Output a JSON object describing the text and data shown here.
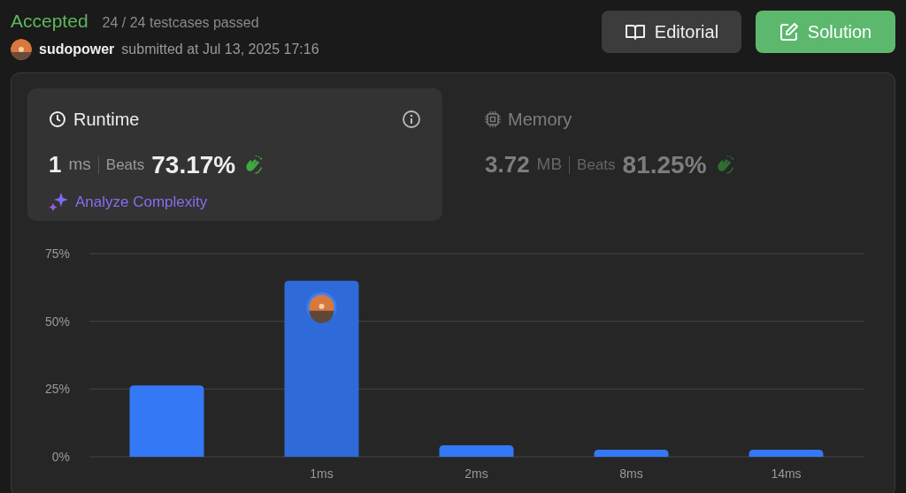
{
  "header": {
    "status": "Accepted",
    "testcases": "24 / 24 testcases passed",
    "user": "sudopower",
    "submitted": "submitted at Jul 13, 2025 17:16"
  },
  "buttons": [
    {
      "label": "Editorial",
      "kind": "editorial"
    },
    {
      "label": "Solution",
      "kind": "solution"
    }
  ],
  "metrics": [
    {
      "kind": "runtime",
      "title": "Runtime",
      "value": "1",
      "unit": "ms",
      "beats_label": "Beats",
      "beats": "73.17%",
      "selected": true,
      "action": "Analyze Complexity"
    },
    {
      "kind": "memory",
      "title": "Memory",
      "value": "3.72",
      "unit": "MB",
      "beats_label": "Beats",
      "beats": "81.25%",
      "selected": false
    }
  ],
  "chart": {
    "bars": [
      {
        "selected": false
      },
      {
        "selected": true
      },
      {
        "selected": false
      },
      {
        "selected": false
      },
      {
        "selected": false
      }
    ],
    "chart_data": {
      "type": "bar",
      "categories": [
        null,
        "1ms",
        "2ms",
        "8ms",
        "14ms"
      ],
      "series": [
        {
          "color": "#3478f6",
          "values": [
            26.3,
            65,
            4.2,
            2.6,
            2.6
          ]
        }
      ],
      "ylim": [
        0,
        75
      ],
      "yticks": [
        {
          "value": 0,
          "label": "0%"
        },
        {
          "value": 25,
          "label": "25%"
        },
        {
          "value": 50,
          "label": "50%"
        },
        {
          "value": 75,
          "label": "75%"
        }
      ]
    }
  }
}
